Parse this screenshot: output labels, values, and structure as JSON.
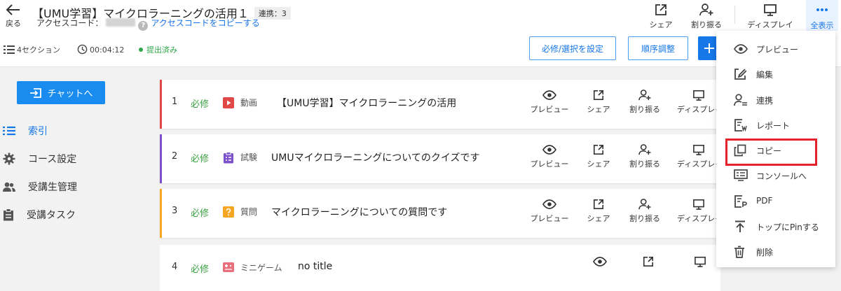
{
  "header": {
    "back_label": "戻る",
    "title": "【UMU学習】マイクロラーニングの活用１",
    "link_badge": "連携：3",
    "access_code_label": "アクセスコード：",
    "help_glyph": "?",
    "copy_access_code": "アクセスコードをコピーする",
    "actions": {
      "share": "シェア",
      "assign": "割り振る",
      "display": "ディスプレイ",
      "show_all": "全表示"
    }
  },
  "meta": {
    "sections": "4セクション",
    "duration": "00:04:12",
    "status": "提出済み"
  },
  "toolbar": {
    "required_select": "必修/選択を設定",
    "reorder": "順序調整"
  },
  "sidebar": {
    "chat_button": "チャットへ",
    "items": [
      {
        "label": "索引",
        "icon": "list-icon",
        "active": true
      },
      {
        "label": "コース設定",
        "icon": "gear-icon",
        "active": false
      },
      {
        "label": "受講生管理",
        "icon": "users-icon",
        "active": false
      },
      {
        "label": "受講タスク",
        "icon": "clipboard-icon",
        "active": false
      }
    ]
  },
  "sections": [
    {
      "num": "1",
      "req": "必修",
      "type": "動画",
      "title": "【UMU学習】マイクロラーニングの活用",
      "color": "#e04848",
      "icon": "video-icon"
    },
    {
      "num": "2",
      "req": "必修",
      "type": "試験",
      "title": "UMUマイクロラーニングについてのクイズです",
      "color": "#7b52c7",
      "icon": "exam-icon"
    },
    {
      "num": "3",
      "req": "必修",
      "type": "質問",
      "title": "マイクロラーニングについての質問です",
      "color": "#f5a623",
      "icon": "question-icon"
    },
    {
      "num": "4",
      "req": "必修",
      "type": "ミニゲーム",
      "title": "no title",
      "color": "#ffffff",
      "icon": "game-icon"
    }
  ],
  "row_actions": {
    "preview": "プレビュー",
    "share": "シェア",
    "assign": "割り振る",
    "display": "ディスプレイ"
  },
  "menu": {
    "items": [
      {
        "label": "プレビュー",
        "icon": "eye-icon"
      },
      {
        "label": "編集",
        "icon": "edit-icon"
      },
      {
        "label": "連携",
        "icon": "link-user-icon"
      },
      {
        "label": "レポート",
        "icon": "report-icon"
      },
      {
        "label": "コピー",
        "icon": "copy-icon"
      },
      {
        "label": "コンソールへ",
        "icon": "console-icon"
      },
      {
        "label": "PDF",
        "icon": "pdf-icon"
      },
      {
        "label": "トップにPinする",
        "icon": "pin-top-icon"
      },
      {
        "label": "削除",
        "icon": "trash-icon"
      }
    ],
    "highlighted": "コピー"
  },
  "colors": {
    "accent": "#1677e8",
    "required": "#3aa241",
    "highlight": "#e5212c"
  }
}
